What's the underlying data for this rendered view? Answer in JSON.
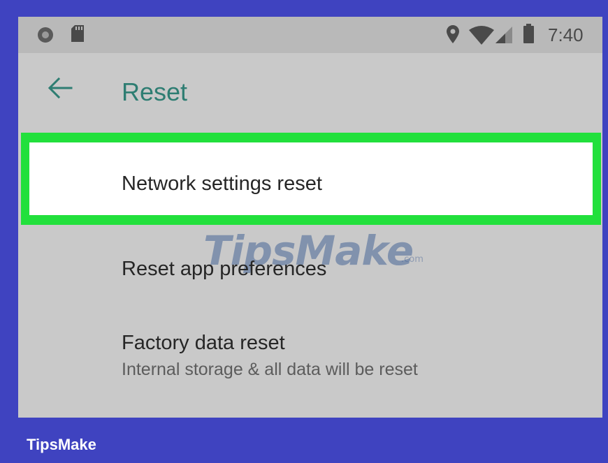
{
  "statusbar": {
    "time": "7:40",
    "icons_left": [
      "screen-record-icon",
      "sd-card-icon"
    ],
    "icons_right": [
      "location-icon",
      "wifi-icon",
      "signal-icon",
      "battery-icon"
    ]
  },
  "appbar": {
    "title": "Reset",
    "back_icon": "back-arrow-icon"
  },
  "items": [
    {
      "label": "Network settings reset",
      "subtitle": "",
      "highlighted": true
    },
    {
      "label": "Reset app preferences",
      "subtitle": ""
    },
    {
      "label": "Factory data reset",
      "subtitle": "Internal storage & all data will be reset"
    }
  ],
  "watermark": {
    "text": "TipsMake",
    "suffix": ".com"
  },
  "footer": {
    "brand": "TipsMake"
  },
  "colors": {
    "frame": "#3f43c0",
    "screen_bg": "#c9c9c9",
    "statusbar_bg": "#b9b9b9",
    "accent": "#2e7d72",
    "highlight": "#22e03c"
  }
}
